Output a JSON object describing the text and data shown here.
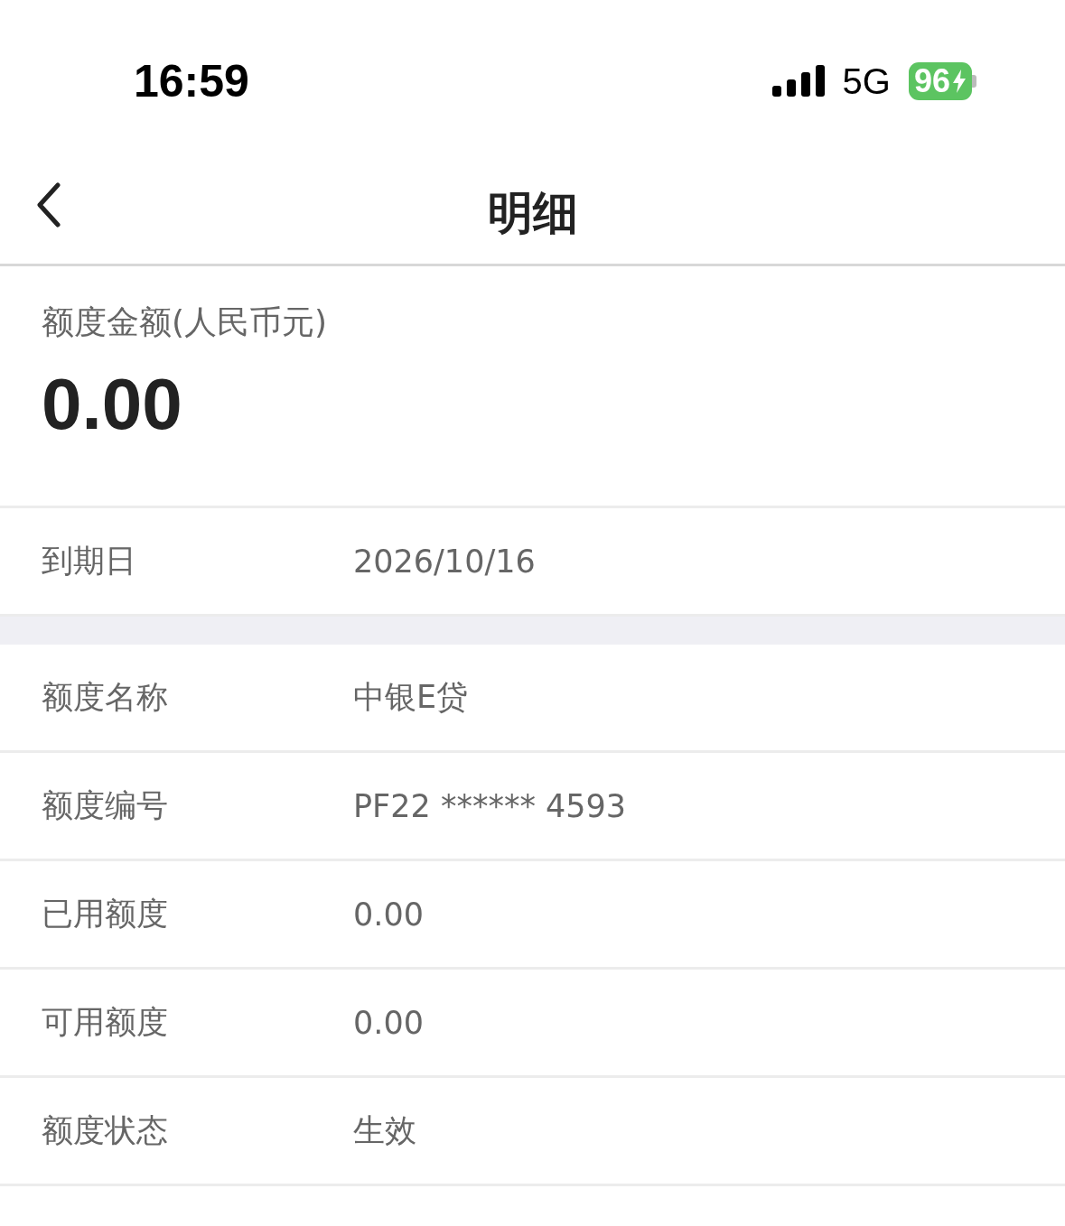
{
  "status_bar": {
    "time": "16:59",
    "network": "5G",
    "battery": "96"
  },
  "nav": {
    "title": "明细"
  },
  "summary": {
    "label": "额度金额(人民币元)",
    "amount": "0.00"
  },
  "expiry": {
    "label": "到期日",
    "value": "2026/10/16"
  },
  "details": [
    {
      "label": "额度名称",
      "value": "中银E贷"
    },
    {
      "label": "额度编号",
      "value": "PF22 ****** 4593"
    },
    {
      "label": "已用额度",
      "value": "0.00"
    },
    {
      "label": "可用额度",
      "value": "0.00"
    },
    {
      "label": "额度状态",
      "value": "生效"
    }
  ]
}
